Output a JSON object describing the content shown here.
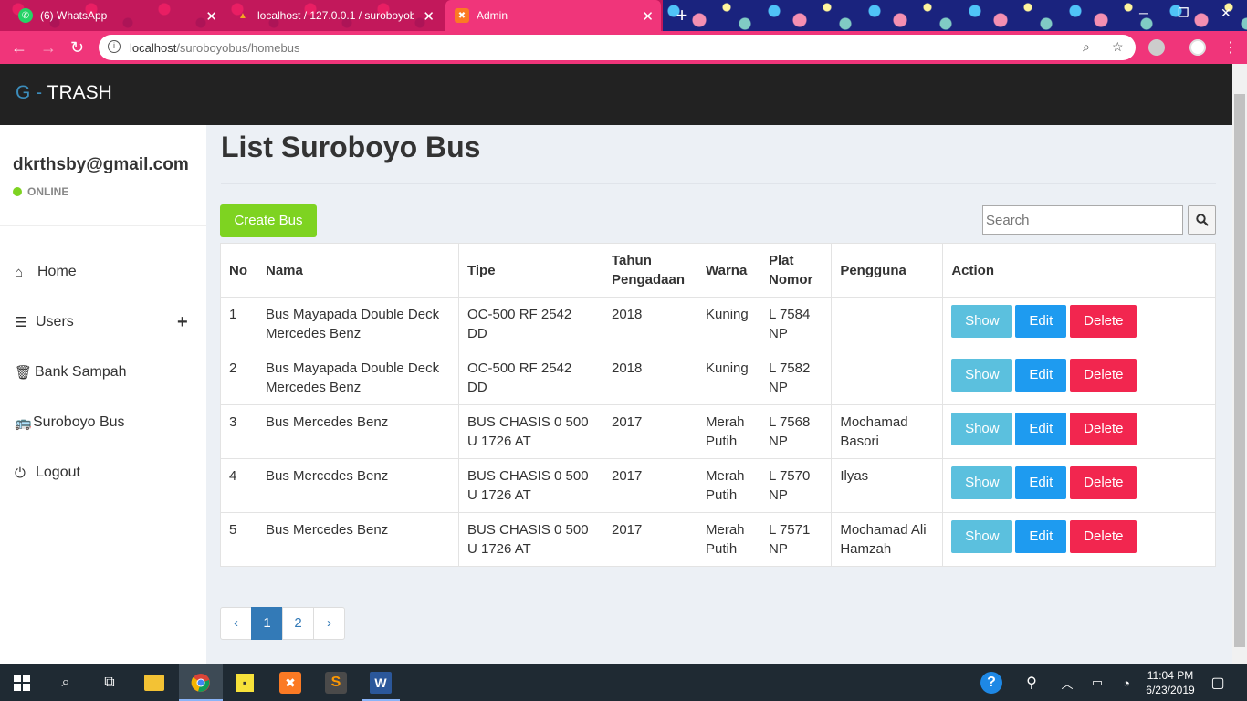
{
  "browser": {
    "tabs": [
      {
        "title": "(6) WhatsApp",
        "icon": "whatsapp-icon"
      },
      {
        "title": "localhost / 127.0.0.1 / suroboyob",
        "icon": "phpmyadmin-icon"
      },
      {
        "title": "Admin",
        "icon": "xampp-icon"
      }
    ],
    "url_host": "localhost",
    "url_path": "/suroboyobus/homebus"
  },
  "app": {
    "brand_prefix": "G - ",
    "brand_name": "TRASH"
  },
  "sidebar": {
    "email": "dkrthsby@gmail.com",
    "status": "ONLINE",
    "items": [
      {
        "label": "Home",
        "icon": "home-icon"
      },
      {
        "label": "Users",
        "icon": "bars-icon"
      },
      {
        "label": "Bank Sampah",
        "icon": "trash-icon"
      },
      {
        "label": "Suroboyo Bus",
        "icon": "bus-icon"
      },
      {
        "label": "Logout",
        "icon": "power-icon"
      }
    ]
  },
  "main": {
    "title": "List Suroboyo Bus",
    "create_label": "Create Bus",
    "search_placeholder": "Search",
    "columns": [
      "No",
      "Nama",
      "Tipe",
      "Tahun Pengadaan",
      "Warna",
      "Plat Nomor",
      "Pengguna",
      "Action"
    ],
    "rows": [
      {
        "no": "1",
        "nama": "Bus Mayapada Double Deck Mercedes Benz",
        "tipe": "OC-500 RF 2542 DD",
        "tahun": "2018",
        "warna": "Kuning",
        "plat": "L 7584 NP",
        "pengguna": ""
      },
      {
        "no": "2",
        "nama": "Bus Mayapada Double Deck Mercedes Benz",
        "tipe": "OC-500 RF 2542 DD",
        "tahun": "2018",
        "warna": "Kuning",
        "plat": "L 7582 NP",
        "pengguna": ""
      },
      {
        "no": "3",
        "nama": "Bus Mercedes Benz",
        "tipe": "BUS CHASIS 0 500 U 1726 AT",
        "tahun": "2017",
        "warna": "Merah Putih",
        "plat": "L 7568 NP",
        "pengguna": "Mochamad Basori"
      },
      {
        "no": "4",
        "nama": "Bus Mercedes Benz",
        "tipe": "BUS CHASIS 0 500 U 1726 AT",
        "tahun": "2017",
        "warna": "Merah Putih",
        "plat": "L 7570 NP",
        "pengguna": "Ilyas"
      },
      {
        "no": "5",
        "nama": "Bus Mercedes Benz",
        "tipe": "BUS CHASIS 0 500 U 1726 AT",
        "tahun": "2017",
        "warna": "Merah Putih",
        "plat": "L 7571 NP",
        "pengguna": "Mochamad Ali Hamzah"
      }
    ],
    "actions": {
      "show": "Show",
      "edit": "Edit",
      "delete": "Delete"
    },
    "pagination": {
      "prev": "‹",
      "pages": [
        "1",
        "2"
      ],
      "active": "1",
      "next": "›"
    }
  },
  "taskbar": {
    "time": "11:04 PM",
    "date": "6/23/2019"
  },
  "colors": {
    "accent_pink": "#f0357a",
    "header_dark": "#222222",
    "brand_blue": "#3c8dbc",
    "create_green": "#7ed321",
    "show_btn": "#5bc0de",
    "edit_btn": "#1e9bf0",
    "delete_btn": "#f2264f",
    "online_dot": "#7ed321"
  }
}
